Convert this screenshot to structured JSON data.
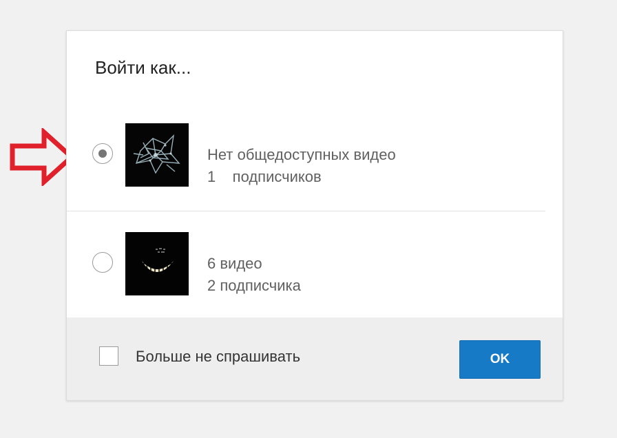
{
  "dialog": {
    "title": "Войти как..."
  },
  "accounts": [
    {
      "selected": true,
      "videos_text": "Нет общедоступных видео",
      "subscribers_text": "1    подписчиков",
      "avatar_icon": "dark-abstract-avatar"
    },
    {
      "selected": false,
      "videos_text": "6 видео",
      "subscribers_text": "2 подписчика",
      "avatar_icon": "cheshire-grin-avatar"
    }
  ],
  "footer": {
    "checkbox_label": "Больше не спрашивать",
    "checkbox_checked": false,
    "ok_label": "OK"
  },
  "colors": {
    "accent_button": "#167ac6",
    "arrow_annotation": "#e0202a"
  }
}
